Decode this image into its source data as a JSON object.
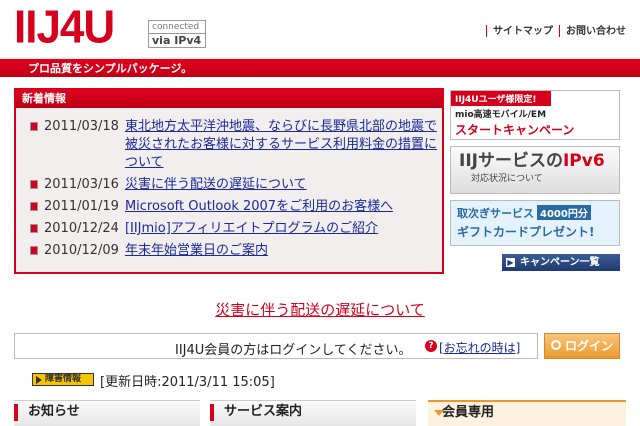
{
  "header": {
    "logo": "IIJ4U",
    "via_top": "connected",
    "via_bottom": "via IPv4",
    "links": [
      "サイトマップ",
      "お問い合わせ"
    ],
    "tagline": "プロ品質をシンプルパッケージ。"
  },
  "news": {
    "title": "新着情報",
    "items": [
      {
        "date": "2011/03/18",
        "text": "東北地方太平洋沖地震、ならびに長野県北部の地震で被災されたお客様に対するサービス利用料金の措置について"
      },
      {
        "date": "2011/03/16",
        "text": "災害に伴う配送の遅延について"
      },
      {
        "date": "2011/01/19",
        "text": "Microsoft Outlook 2007をご利用のお客様へ"
      },
      {
        "date": "2010/12/24",
        "text": "[IIJmio]アフィリエイトプログラムのご紹介"
      },
      {
        "date": "2010/12/09",
        "text": "年末年始営業日のご案内"
      }
    ]
  },
  "banners": {
    "b1_top": "IIJ4Uユーザ様限定!",
    "b1_mid": "mio高速モバイル/EM",
    "b1_main": "スタートキャンペーン",
    "b2_main_a": "IIJサービスの",
    "b2_main_b": "IPv6",
    "b2_sub": "対応状況について",
    "b3_top": "取次ぎサービス",
    "b3_badge": "4000円分",
    "b3_main": "ギフトカードプレゼント!",
    "campaign_list": "キャンペーン一覧"
  },
  "notice": "災害に伴う配送の遅延について",
  "login": {
    "prompt": "IIJ4U会員の方はログインしてください。",
    "forgot": "[お忘れの時は]",
    "button": "ログイン"
  },
  "status": {
    "badge": "障害情報",
    "text": "[更新日時:2011/3/11 15:05]"
  },
  "sections": [
    "お知らせ",
    "サービス案内",
    "会員専用"
  ]
}
